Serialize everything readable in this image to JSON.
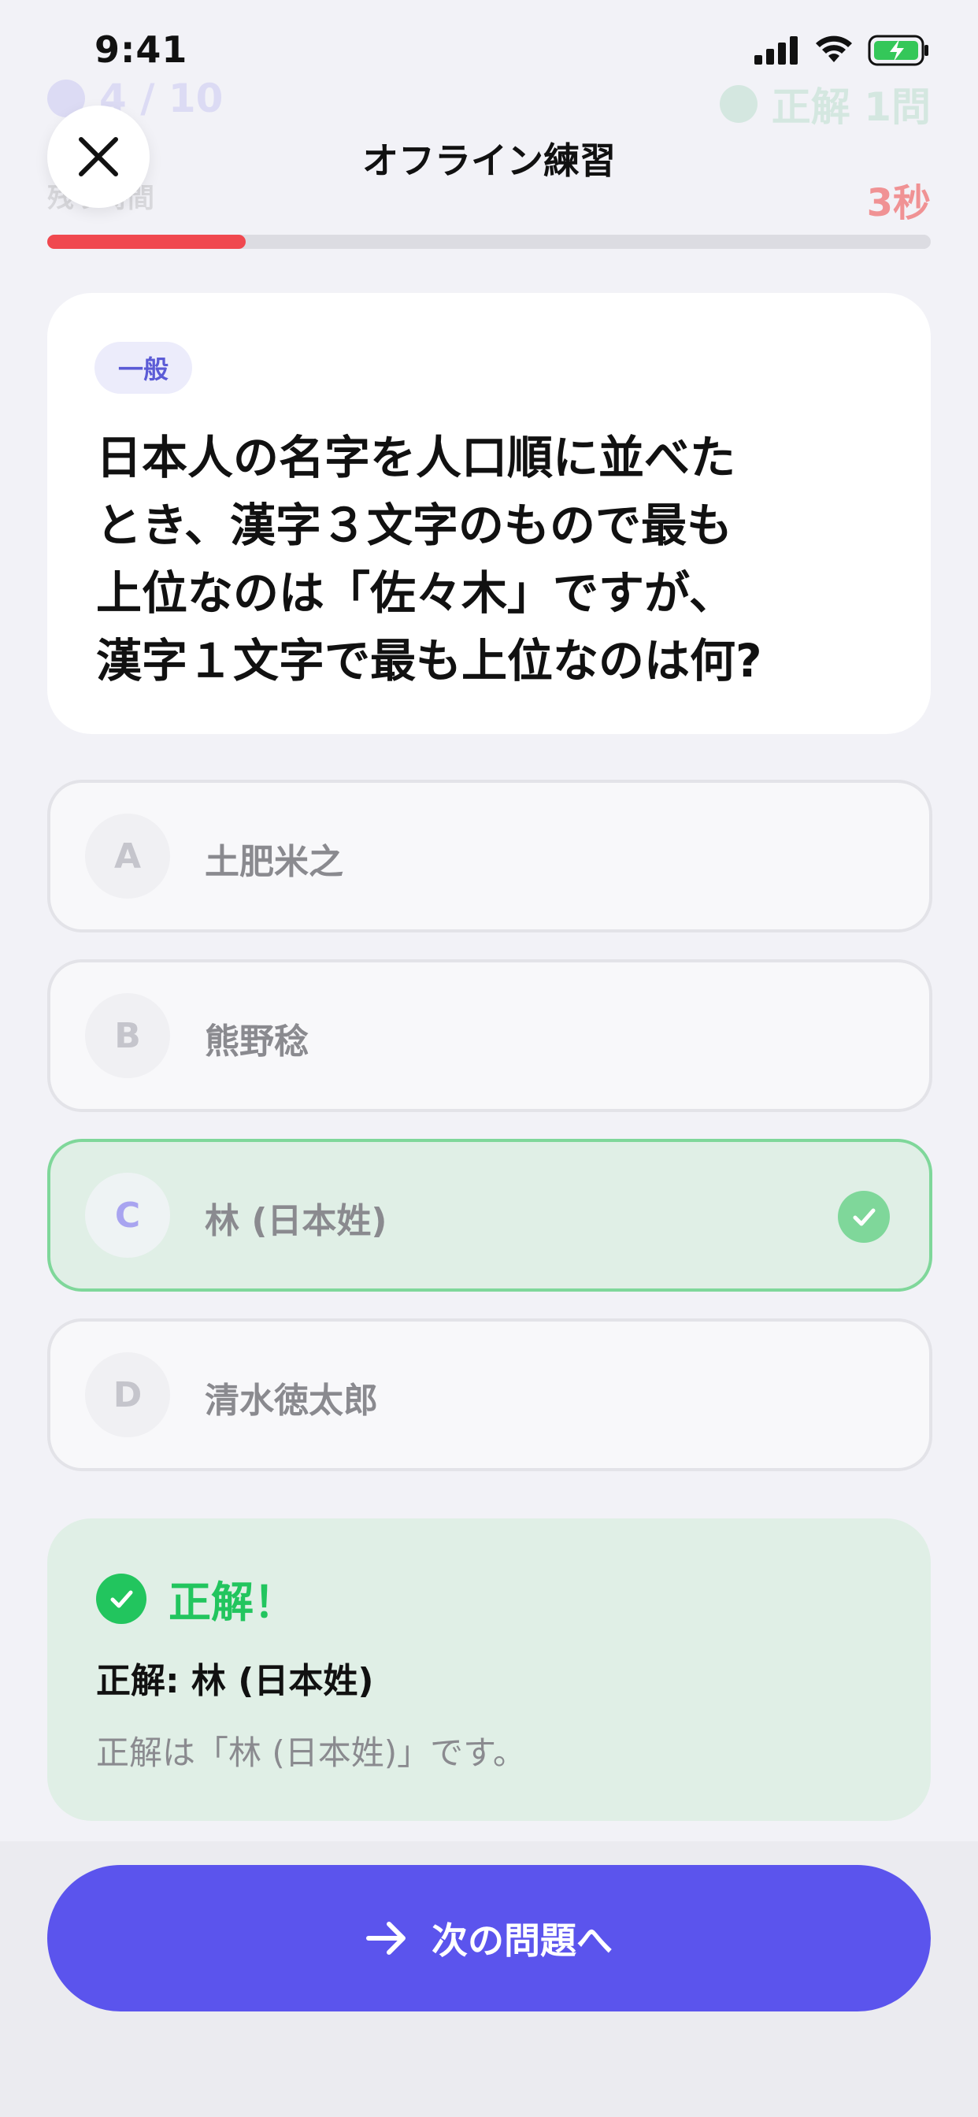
{
  "status_bar": {
    "time": "9:41"
  },
  "background_header": {
    "progress": "4 / 10",
    "correct_count": "正解 1問",
    "time_label": "残り時間"
  },
  "nav": {
    "title": "オフライン練習",
    "timer": "3秒",
    "progress_fraction": 0.225
  },
  "question": {
    "category": "一般",
    "text": "日本人の名字を人口順に並べた\nとき、漢字３文字のもので最も\n上位なのは「佐々木」ですが、\n漢字１文字で最も上位なのは何?"
  },
  "options": [
    {
      "letter": "A",
      "label": "土肥米之"
    },
    {
      "letter": "B",
      "label": "熊野稔"
    },
    {
      "letter": "C",
      "label": "林 (日本姓)"
    },
    {
      "letter": "D",
      "label": "清水徳太郎"
    }
  ],
  "correct_option_index": 2,
  "feedback": {
    "title": "正解！",
    "answer": "正解: 林 (日本姓)",
    "explanation": "正解は「林 (日本姓)」です。"
  },
  "next_button": {
    "label": "次の問題へ"
  },
  "colors": {
    "accent": "#5b54ed",
    "correct": "#22c55e",
    "timer": "#ef4444",
    "progress": "#f0484f"
  }
}
